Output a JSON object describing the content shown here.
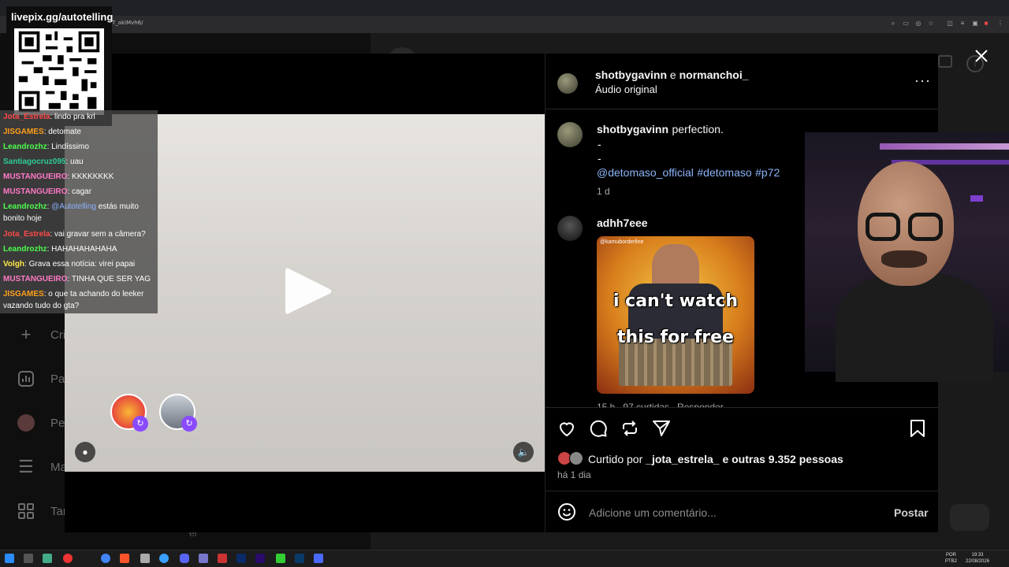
{
  "browser": {
    "url_fragment": "T_akiMvh6/"
  },
  "stream_overlay": {
    "qr_title": "livepix.gg/autotelling",
    "chat": [
      {
        "user": "Jota_Estrela",
        "color": "#ff4a4a",
        "text": ": lindo pra krl"
      },
      {
        "user": "JISGAMES",
        "color": "#ff9f1a",
        "text": ": detomate"
      },
      {
        "user": "Leandrozhz",
        "color": "#4cff4c",
        "text": ": Lindíssimo"
      },
      {
        "user": "Santiagocruz095",
        "color": "#2ecc9a",
        "text": ": uau"
      },
      {
        "user": "MUSTANGUEIRO",
        "color": "#ff79c6",
        "text": ": KKKKKKKK"
      },
      {
        "user": "MUSTANGUEIRO",
        "color": "#ff79c6",
        "text": ": cagar"
      },
      {
        "user": "Leandrozhz",
        "color": "#4cff4c",
        "text": ": @Autotelling estás muito bonito hoje",
        "mention": "@Autotelling"
      },
      {
        "user": "Jota_Estrela",
        "color": "#ff4a4a",
        "text": ": vai gravar sem a câmera?"
      },
      {
        "user": "Leandrozhz",
        "color": "#4cff4c",
        "text": ": HAHAHAHAHAHA"
      },
      {
        "user": "Volgh",
        "color": "#ffe94a",
        "text": ": Grava essa notícia: virei papai"
      },
      {
        "user": "MUSTANGUEIRO",
        "color": "#ff79c6",
        "text": ": TINHA QUE SER YAG"
      },
      {
        "user": "JISGAMES",
        "color": "#ff9f1a",
        "text": ": o que ta achando do leeker vazando tudo do gta?"
      }
    ]
  },
  "background_sidebar": [
    {
      "icon": "plus-icon",
      "label": "Cri"
    },
    {
      "icon": "chart-icon",
      "label": "Pai"
    },
    {
      "icon": "profile-icon",
      "label": "Pe"
    },
    {
      "icon": "menu-icon",
      "label": "Ma"
    },
    {
      "icon": "apps-icon",
      "label": "Tam"
    }
  ],
  "post": {
    "header": {
      "author1": "shotbygavinn",
      "connector": "e",
      "author2": "normanchoi_",
      "audio": "Áudio original"
    },
    "caption": {
      "user": "shotbygavinn",
      "text": "perfection.",
      "dash1": "-",
      "dash2": "-",
      "mention": "@detomaso_official",
      "tag1": "#detomaso",
      "tag2": "#p72",
      "time": "1 d"
    },
    "comment": {
      "user": "adhh7eee",
      "meme_line1": "i can't watch",
      "meme_line2": "this for free",
      "meme_watermark": "@kamuborderline",
      "meta": "15 h   97 curtidas   Responder"
    },
    "likes": {
      "prefix": "Curtido por",
      "user": "_jota_estrela_",
      "suffix": "e outras 9.352 pessoas"
    },
    "time": "há 1 dia",
    "comment_placeholder": "Adicione um comentário...",
    "post_button": "Postar"
  },
  "taskbar": {
    "lang": "POR",
    "lang2": "PTB2",
    "time": "19:33",
    "date": "22/08/2026"
  },
  "colors": {
    "panel_bg": "#000000",
    "link": "#e0f1ff",
    "hashtag": "#8ab4f8"
  }
}
